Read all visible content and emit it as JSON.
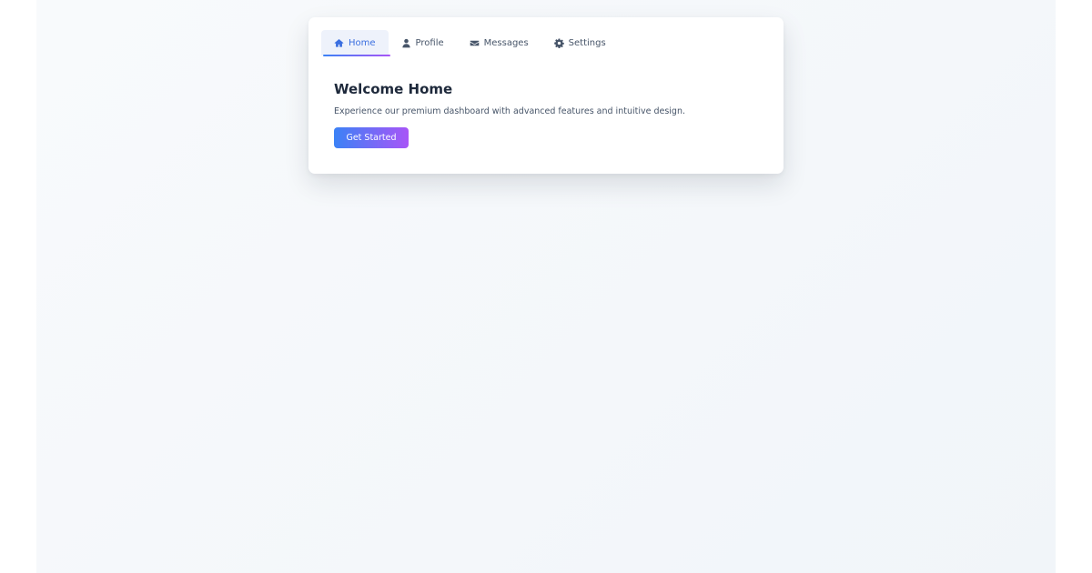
{
  "tabs": [
    {
      "label": "Home",
      "icon": "home-icon",
      "active": true
    },
    {
      "label": "Profile",
      "icon": "user-icon",
      "active": false
    },
    {
      "label": "Messages",
      "icon": "envelope-icon",
      "active": false
    },
    {
      "label": "Settings",
      "icon": "gear-icon",
      "active": false
    }
  ],
  "panel": {
    "title": "Welcome Home",
    "description": "Experience our premium dashboard with advanced features and intuitive design.",
    "button_label": "Get Started"
  },
  "colors": {
    "accent_start": "#3b82f6",
    "accent_end": "#a855f7",
    "active_tab_text": "#3b6fe0",
    "text": "#1e293b",
    "muted": "#475569"
  }
}
